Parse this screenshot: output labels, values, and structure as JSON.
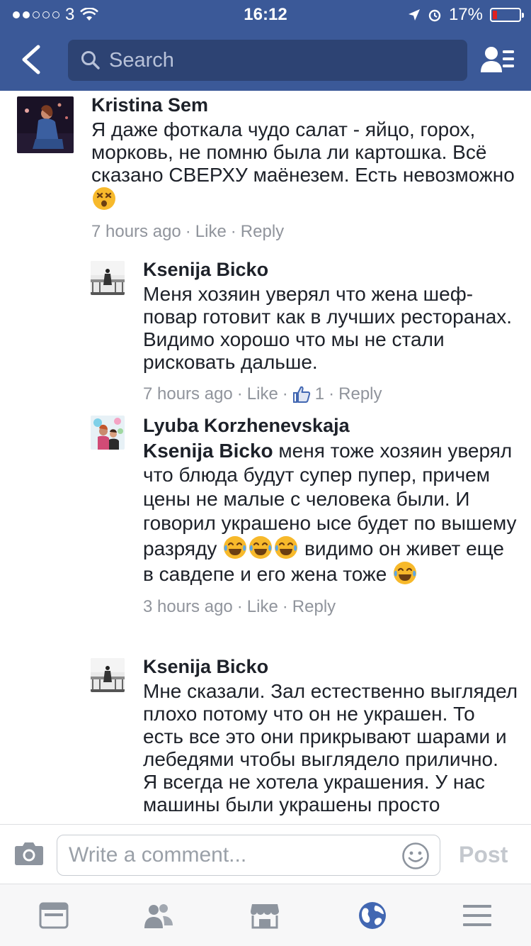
{
  "status_bar": {
    "carrier": "3",
    "time": "16:12",
    "battery": "17%"
  },
  "nav": {
    "search_placeholder": "Search"
  },
  "comments": [
    {
      "author": "Kristina Sem",
      "text": "Я даже фоткала чудо салат - яйцо, горох, морковь, не помню была ли картошка. Всё сказано СВЕРХУ маёнезем.  Есть невозможно",
      "time": "7 hours ago",
      "like": "Like",
      "reply": "Reply"
    },
    {
      "author": "Ksenija Bicko",
      "text": "Меня хозяин уверял что жена шеф-повар готовит как в лучших ресторанах. Видимо хорошо что мы не стали рисковать дальше.",
      "time": "7 hours ago",
      "like": "Like",
      "like_count": "1",
      "reply": "Reply"
    },
    {
      "author": "Lyuba Korzhenevskaja",
      "mention": "Ksenija Bicko",
      "text_part1": "  меня тоже хозяин уверял что блюда будут супер пупер, причем цены не малые с человека были. И говорил украшено ысе будет по вышему разряду",
      "text_part2": "видимо он живет еще в савдепе и его жена тоже",
      "time": "3 hours ago",
      "like": "Like",
      "reply": "Reply"
    },
    {
      "author": "Ksenija Bicko",
      "text": "Мне сказали. Зал естественно выглядел плохо потому что он не украшен. То есть все это они прикрывают шарами и лебедями чтобы выглядело прилично.",
      "text2": "Я всегда не хотела украшения. У нас машины были украшены просто"
    }
  ],
  "composer": {
    "placeholder": "Write a comment...",
    "post_label": "Post"
  },
  "colors": {
    "brand": "#3b5998",
    "search_bg": "#2d4373",
    "meta_text": "#90949c",
    "active_tab": "#4267b2"
  },
  "icons": [
    "back-icon",
    "search-icon",
    "friend-requests-icon",
    "camera-icon",
    "emoji-icon",
    "news-feed-icon",
    "groups-icon",
    "marketplace-icon",
    "globe-icon",
    "menu-icon",
    "thumbs-up-icon"
  ]
}
